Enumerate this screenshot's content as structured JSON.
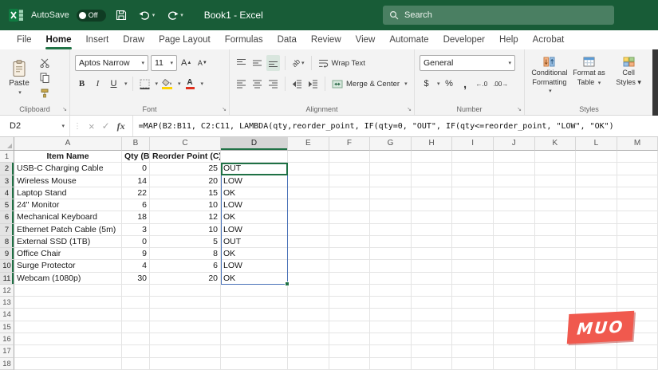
{
  "title_bar": {
    "autosave_label": "AutoSave",
    "autosave_state": "Off",
    "window_title": "Book1 - Excel",
    "search_placeholder": "Search"
  },
  "menu": {
    "tabs": [
      "File",
      "Home",
      "Insert",
      "Draw",
      "Page Layout",
      "Formulas",
      "Data",
      "Review",
      "View",
      "Automate",
      "Developer",
      "Help",
      "Acrobat"
    ],
    "active_tab": "Home"
  },
  "ribbon": {
    "paste_label": "Paste",
    "clipboard_group": "Clipboard",
    "font_name": "Aptos Narrow",
    "font_size": "11",
    "bold": "B",
    "italic": "I",
    "underline": "U",
    "font_group": "Font",
    "wrap_text": "Wrap Text",
    "merge_center": "Merge & Center",
    "orientation": "ab",
    "alignment_group": "Alignment",
    "number_format": "General",
    "currency": "$",
    "percent": "%",
    "comma": ",",
    "increase_decimal": "←.0",
    "decrease_decimal": ".00→",
    "number_group": "Number",
    "cond_fmt_line1": "Conditional",
    "cond_fmt_line2": "Formatting",
    "fmt_table_line1": "Format as",
    "fmt_table_line2": "Table",
    "cell_styles_line1": "Cell",
    "cell_styles_line2": "Styles ▾",
    "styles_group": "Styles"
  },
  "formula_bar": {
    "name_box": "D2",
    "cancel": "×",
    "enter": "✓",
    "fx": "fx",
    "formula": "=MAP(B2:B11, C2:C11, LAMBDA(qty,reorder_point, IF(qty=0, \"OUT\", IF(qty<=reorder_point, \"LOW\", \"OK\")"
  },
  "sheet": {
    "columns": [
      "A",
      "B",
      "C",
      "D",
      "E",
      "F",
      "G",
      "H",
      "I",
      "J",
      "K",
      "L",
      "M"
    ],
    "total_rows": 18,
    "selected_cell": "D2",
    "selected_column": "D",
    "selected_rows_start": 2,
    "selected_rows_end": 11,
    "spill_range": "D2:D11",
    "header_row": {
      "a": "Item Name",
      "b": "Qty (B)",
      "c": "Reorder Point (C)"
    },
    "rows": [
      {
        "item": "USB-C Charging Cable",
        "qty": 0,
        "reorder": 25,
        "status": "OUT"
      },
      {
        "item": "Wireless Mouse",
        "qty": 14,
        "reorder": 20,
        "status": "LOW"
      },
      {
        "item": "Laptop Stand",
        "qty": 22,
        "reorder": 15,
        "status": "OK"
      },
      {
        "item": "24\" Monitor",
        "qty": 6,
        "reorder": 10,
        "status": "LOW"
      },
      {
        "item": "Mechanical Keyboard",
        "qty": 18,
        "reorder": 12,
        "status": "OK"
      },
      {
        "item": "Ethernet Patch Cable (5m)",
        "qty": 3,
        "reorder": 10,
        "status": "LOW"
      },
      {
        "item": "External SSD (1TB)",
        "qty": 0,
        "reorder": 5,
        "status": "OUT"
      },
      {
        "item": "Office Chair",
        "qty": 9,
        "reorder": 8,
        "status": "OK"
      },
      {
        "item": "Surge Protector",
        "qty": 4,
        "reorder": 6,
        "status": "LOW"
      },
      {
        "item": "Webcam (1080p)",
        "qty": 30,
        "reorder": 20,
        "status": "OK"
      }
    ]
  },
  "watermark": {
    "text": "MUO"
  },
  "colors": {
    "titlebar_green": "#185c37",
    "accent_green": "#217346",
    "selection_green": "#1f7145",
    "spill_blue": "#4a72b8",
    "watermark_red": "#f0594e",
    "fill_color_swatch": "#ffd400",
    "font_color_swatch": "#e0301e"
  }
}
